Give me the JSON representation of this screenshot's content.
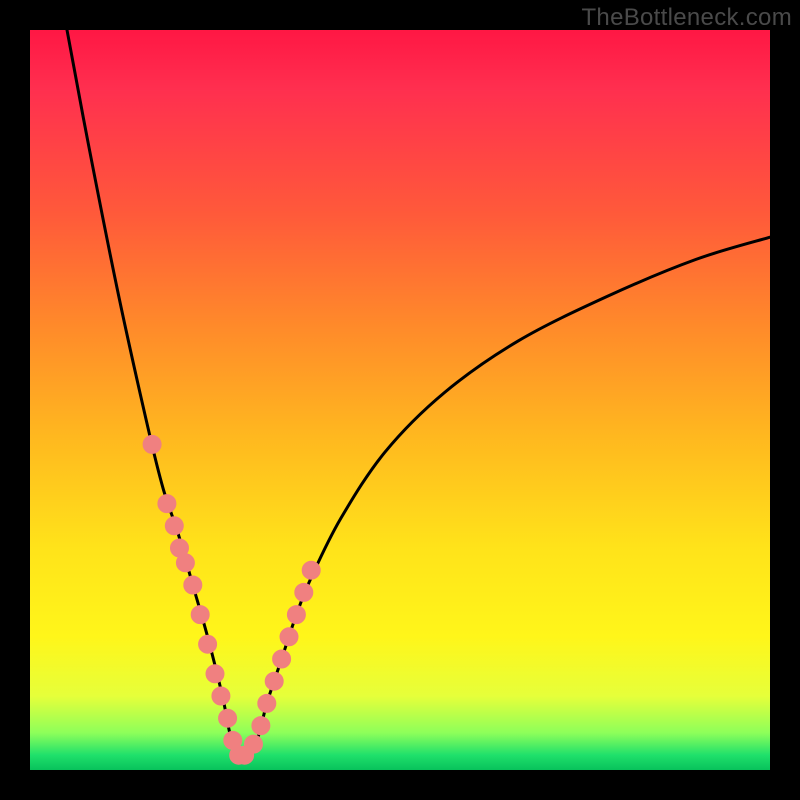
{
  "attribution": {
    "watermark": "TheBottleneck.com"
  },
  "colors": {
    "background": "#000000",
    "curve_stroke": "#000000",
    "marker_fill": "#f08080",
    "marker_stroke": "#f08080",
    "gradient_top": "#ff1744",
    "gradient_bottom": "#08c25b"
  },
  "chart_data": {
    "type": "line",
    "title": "",
    "xlabel": "",
    "ylabel": "",
    "xlim": [
      0,
      100
    ],
    "ylim": [
      0,
      100
    ],
    "grid": false,
    "legend": false,
    "notes": "V-shaped bottleneck curve on red-to-green vertical gradient. Minimum (optimal match) near x≈28. Left branch rises steeply to 100 at x≈5; right branch rises asymptotically toward ~72 at x=100. Salmon markers cluster along both branches in the lower ~35% band.",
    "series": [
      {
        "name": "bottleneck_curve",
        "x": [
          5,
          8,
          12,
          16,
          18,
          20,
          22,
          24,
          26,
          27,
          28,
          29,
          30,
          31,
          32,
          34,
          36,
          38,
          42,
          48,
          56,
          66,
          78,
          90,
          100
        ],
        "y": [
          100,
          84,
          64,
          46,
          38,
          32,
          25,
          18,
          10,
          5,
          2,
          2,
          3,
          5,
          9,
          15,
          21,
          26,
          34,
          43,
          51,
          58,
          64,
          69,
          72
        ]
      }
    ],
    "markers": {
      "name": "sample_points",
      "x": [
        16.5,
        18.5,
        19.5,
        20.2,
        21.0,
        22.0,
        23.0,
        24.0,
        25.0,
        25.8,
        26.7,
        27.4,
        28.2,
        29.0,
        30.2,
        31.2,
        32.0,
        33.0,
        34.0,
        35.0,
        36.0,
        37.0,
        38.0
      ],
      "y": [
        44,
        36,
        33,
        30,
        28,
        25,
        21,
        17,
        13,
        10,
        7,
        4,
        2,
        2,
        3.5,
        6,
        9,
        12,
        15,
        18,
        21,
        24,
        27
      ]
    }
  }
}
